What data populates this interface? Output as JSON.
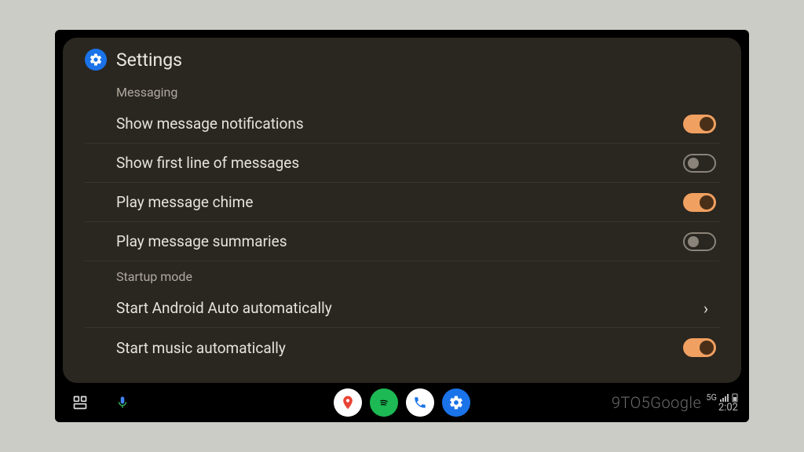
{
  "header": {
    "title": "Settings"
  },
  "sections": {
    "messaging": {
      "label": "Messaging",
      "items": {
        "show_notifications": {
          "label": "Show message notifications",
          "on": true
        },
        "show_first_line": {
          "label": "Show first line of messages",
          "on": false
        },
        "play_chime": {
          "label": "Play message chime",
          "on": true
        },
        "play_summaries": {
          "label": "Play message summaries",
          "on": false
        }
      }
    },
    "startup": {
      "label": "Startup mode",
      "items": {
        "start_auto": {
          "label": "Start Android Auto automatically",
          "type": "link"
        },
        "start_music": {
          "label": "Start music automatically",
          "on": true
        }
      }
    }
  },
  "navbar": {
    "apps": {
      "maps": {
        "bg": "#ffffff"
      },
      "spotify": {
        "bg": "#1db954"
      },
      "phone": {
        "bg": "#ffffff"
      },
      "settings": {
        "bg": "#1a73e8"
      }
    }
  },
  "status": {
    "network": "5G",
    "clock": "2:02"
  },
  "watermark": "9TO5Google"
}
